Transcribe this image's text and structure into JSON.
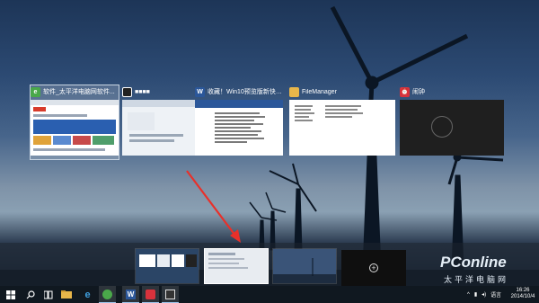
{
  "task_view": {
    "windows": [
      {
        "title": "软件_太平洋电脑网软件...",
        "icon": "browser-icon",
        "icon_color": "#4aa84a",
        "selected": true
      },
      {
        "title": "■■■■",
        "icon": "app-icon",
        "icon_color": "#ffffff",
        "selected": false
      },
      {
        "title": "收藏！Win10预览版新快捷...",
        "icon": "word-icon",
        "icon_color": "#2b579a",
        "selected": false
      },
      {
        "title": "FileManager",
        "icon": "folder-icon",
        "icon_color": "#e8b64a",
        "selected": false
      },
      {
        "title": "闹钟",
        "icon": "alarm-icon",
        "icon_color": "#d8323c",
        "selected": false
      }
    ]
  },
  "desktops": {
    "new_desktop_symbol": "+"
  },
  "taskbar": {
    "items": [
      {
        "name": "start-icon"
      },
      {
        "name": "search-icon"
      },
      {
        "name": "file-explorer-icon"
      },
      {
        "name": "internet-explorer-icon"
      },
      {
        "name": "browser-icon"
      },
      {
        "name": "word-icon"
      },
      {
        "name": "alarm-icon"
      },
      {
        "name": "app-icon"
      }
    ],
    "tray_lang": "语言",
    "time": "16:26",
    "date": "2014/10/4"
  },
  "watermark": {
    "brand": "PConline",
    "subtitle": "太平洋电脑网"
  },
  "colors": {
    "arrow": "#e8302a",
    "taskbar": "#101820",
    "accent": "#9cc3ea"
  }
}
